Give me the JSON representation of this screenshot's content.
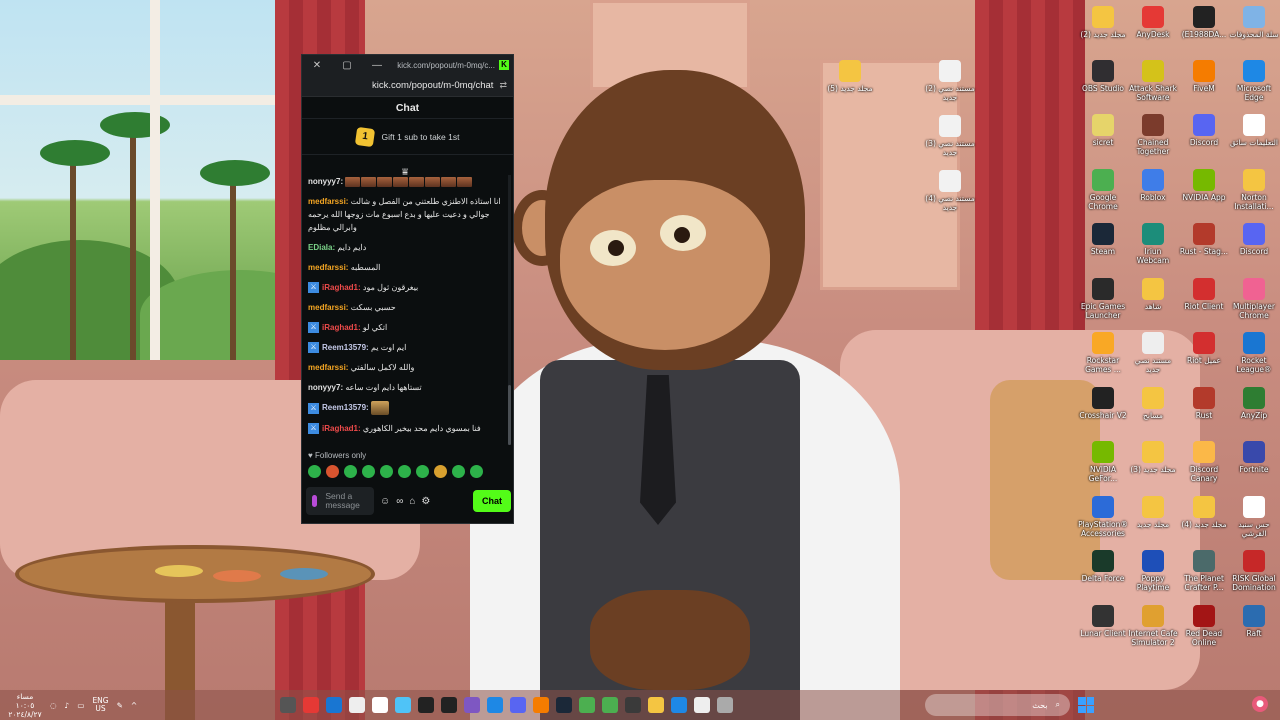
{
  "chat_window": {
    "title": "kick.com/popout/m-0mq/c...",
    "url": "kick.com/popout/m-0mq/chat",
    "header": "Chat",
    "gift_banner": {
      "rank": "1",
      "text": "Gift 1 sub to take 1st"
    },
    "messages": [
      {
        "user": "nonyyy7:",
        "color": "#e0e0e0",
        "mod": false,
        "text": "",
        "emotes": 8
      },
      {
        "user": "medfarssi:",
        "color": "#f5a623",
        "mod": false,
        "text": "انا استاذه الاطنزي طلعتني من الفصل و شالت جوالي و دعيت عليها و بدع اسبوع مات زوجها الله يرحمه وابرالي مظلوم"
      },
      {
        "user": "EDiaIa:",
        "color": "#7bd389",
        "mod": false,
        "text": "دايم دايم"
      },
      {
        "user": "medfarssi:",
        "color": "#f5a623",
        "mod": false,
        "text": "المسطبه"
      },
      {
        "user": "iRaghad1:",
        "color": "#ef4b4b",
        "mod": true,
        "text": "بيغرقون ثول مود"
      },
      {
        "user": "medfarssi:",
        "color": "#f5a623",
        "mod": false,
        "text": "حسبي بسكت"
      },
      {
        "user": "iRaghad1:",
        "color": "#ef4b4b",
        "mod": true,
        "text": "اتكي لو"
      },
      {
        "user": "Reem13579:",
        "color": "#c5cae9",
        "mod": true,
        "text": "ايم اوت يم"
      },
      {
        "user": "medfarssi:",
        "color": "#f5a623",
        "mod": false,
        "text": "والله لاكمل سالفتي"
      },
      {
        "user": "nonyyy7:",
        "color": "#e0e0e0",
        "mod": false,
        "text": "تستاهها دايم اوت ساعه"
      },
      {
        "user": "Reem13579:",
        "color": "#c5cae9",
        "mod": true,
        "text": "",
        "emotes_big": 1
      },
      {
        "user": "iRaghad1:",
        "color": "#ef4b4b",
        "mod": true,
        "text": "فنا بمسوي دايم محد بيخير الكاهوري"
      }
    ],
    "followers_only": "Followers only",
    "input_placeholder": "Send a message",
    "chat_button": "Chat"
  },
  "desktop_icons": [
    {
      "label": "(2) مجلد جديد",
      "icon": "folder-icon",
      "color": "#f4c542"
    },
    {
      "label": "AnyDesk",
      "icon": "anydesk-icon",
      "color": "#e53935"
    },
    {
      "label": "(E1988DA...",
      "icon": "file-icon",
      "color": "#222222"
    },
    {
      "label": "سلة المحذوفات",
      "icon": "recycle-bin-icon",
      "color": "#7fb3e6"
    },
    {
      "label": "OBS Studio",
      "icon": "obs-icon",
      "color": "#302e31"
    },
    {
      "label": "Attack Shark Software",
      "icon": "attack-shark-icon",
      "color": "#d4c21a"
    },
    {
      "label": "FiveM",
      "icon": "fivem-icon",
      "color": "#f57c00"
    },
    {
      "label": "Microsoft Edge",
      "icon": "edge-icon",
      "color": "#1e88e5"
    },
    {
      "label": "sicret",
      "icon": "sicret-icon",
      "color": "#e6d46a"
    },
    {
      "label": "Chained Together",
      "icon": "chained-together-icon",
      "color": "#7b3b2c"
    },
    {
      "label": "Discord",
      "icon": "discord-icon",
      "color": "#5865f2"
    },
    {
      "label": "التعليمات سائق",
      "icon": "chrome-icon",
      "color": "#ffffff"
    },
    {
      "label": "Google Chrome",
      "icon": "chrome-icon",
      "color": "#4caf50"
    },
    {
      "label": "Roblox",
      "icon": "roblox-icon",
      "color": "#3f7de8"
    },
    {
      "label": "NVIDIA App",
      "icon": "nvidia-icon",
      "color": "#76b900"
    },
    {
      "label": "Norton Installati...",
      "icon": "norton-icon",
      "color": "#f4c542"
    },
    {
      "label": "Steam",
      "icon": "steam-icon",
      "color": "#1b2838"
    },
    {
      "label": "Iriun Webcam",
      "icon": "iriun-icon",
      "color": "#1c8d7a"
    },
    {
      "label": "Rust - Stag...",
      "icon": "rust-icon",
      "color": "#b33a2b"
    },
    {
      "label": "Discord",
      "icon": "discord-icon",
      "color": "#5865f2"
    },
    {
      "label": "Epic Games Launcher",
      "icon": "epic-icon",
      "color": "#2a2a2a"
    },
    {
      "label": "شاهد",
      "icon": "folder-icon",
      "color": "#f4c542"
    },
    {
      "label": "Riot Client",
      "icon": "riot-icon",
      "color": "#d32f2f"
    },
    {
      "label": "Multiplayer Chrome",
      "icon": "chrome-icon",
      "color": "#f06292"
    },
    {
      "label": "Rockstar Games ...",
      "icon": "rockstar-icon",
      "color": "#f9a825"
    },
    {
      "label": "مستند نصي جديد",
      "icon": "file-icon",
      "color": "#eeeeee"
    },
    {
      "label": "Riot عميل",
      "icon": "riot-icon",
      "color": "#d32f2f"
    },
    {
      "label": "Rocket League®",
      "icon": "rocket-league-icon",
      "color": "#1976d2"
    },
    {
      "label": "Crosshair V2",
      "icon": "crosshair-icon",
      "color": "#222222"
    },
    {
      "label": "مسابح",
      "icon": "folder-icon",
      "color": "#f4c542"
    },
    {
      "label": "Rust",
      "icon": "rust-icon",
      "color": "#b33a2b"
    },
    {
      "label": "AnyZip",
      "icon": "anyzip-icon",
      "color": "#2e7d32"
    },
    {
      "label": "NVIDIA GeFor...",
      "icon": "nvidia-icon",
      "color": "#76b900"
    },
    {
      "label": "(3) مجلد جديد",
      "icon": "folder-icon",
      "color": "#f4c542"
    },
    {
      "label": "Discord Canary",
      "icon": "discord-canary-icon",
      "color": "#fbb848"
    },
    {
      "label": "Fortnite",
      "icon": "fortnite-icon",
      "color": "#3949ab"
    },
    {
      "label": "PlayStation® Accessories",
      "icon": "playstation-icon",
      "color": "#2c6bd8"
    },
    {
      "label": "مجلد جديد",
      "icon": "folder-icon",
      "color": "#f4c542"
    },
    {
      "label": "(4) مجلد جديد",
      "icon": "folder-icon",
      "color": "#f4c542"
    },
    {
      "label": "حس سنيد القرشي",
      "icon": "chrome-icon",
      "color": "#ffffff"
    },
    {
      "label": "Delta Force",
      "icon": "delta-force-icon",
      "color": "#1a3a2a"
    },
    {
      "label": "Poppy Playtime",
      "icon": "poppy-playtime-icon",
      "color": "#1e4fb8"
    },
    {
      "label": "The Planet Crafter P...",
      "icon": "planet-crafter-icon",
      "color": "#4b6a6a"
    },
    {
      "label": "RISK Global Domination",
      "icon": "risk-icon",
      "color": "#c62828"
    },
    {
      "label": "Lunar Client",
      "icon": "lunar-icon",
      "color": "#333333"
    },
    {
      "label": "Internet Cafe Simulator 2",
      "icon": "internet-cafe-icon",
      "color": "#e0a030"
    },
    {
      "label": "Red Dead Online",
      "icon": "red-dead-icon",
      "color": "#a31515"
    },
    {
      "label": "Raft",
      "icon": "raft-icon",
      "color": "#2b6cb0"
    }
  ],
  "mid_icons": [
    {
      "label": "(5) مجلد جديد",
      "icon": "folder-icon"
    },
    {
      "label": "مستند نصي (2) جديد",
      "icon": "file-icon"
    },
    {
      "label": "مستند نصي (3) جديد",
      "icon": "file-icon"
    },
    {
      "label": "مستند نصي (4) جديد",
      "icon": "file-icon"
    }
  ],
  "taskbar": {
    "time": "مساء ١٠:٠٥",
    "date": "٢٠٢٤/٨/٢٧",
    "lang_top": "ENG",
    "lang_bottom": "US",
    "search_placeholder": "بحث",
    "apps": [
      "#555",
      "#e53935",
      "#1976d2",
      "#eeeeee",
      "#ffffff",
      "#4fc3f7",
      "#222222",
      "#222222",
      "#7e57c2",
      "#1e88e5",
      "#5865f2",
      "#f57c00",
      "#1b2838",
      "#4caf50",
      "#4caf50",
      "#3a3a3a",
      "#f4c542",
      "#1e88e5",
      "#eeeeee",
      "#aaaaaa"
    ]
  }
}
